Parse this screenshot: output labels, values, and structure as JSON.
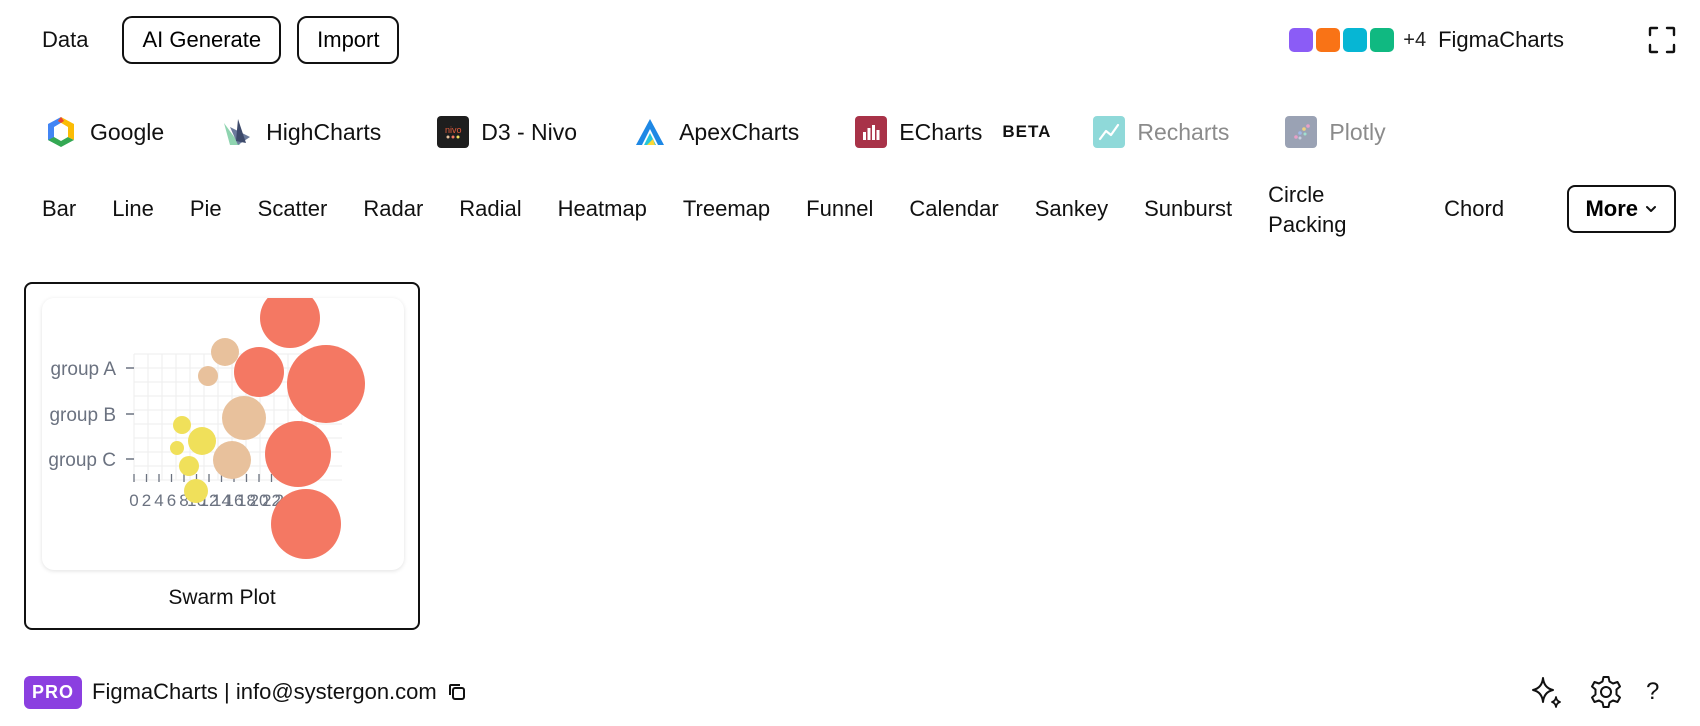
{
  "topbar": {
    "tab_data": "Data",
    "ai_generate_label": "AI Generate",
    "import_label": "Import",
    "brand": {
      "swatches": [
        "#8b5cf6",
        "#f97316",
        "#06b6d4",
        "#10b981"
      ],
      "extra_count": "+4",
      "name": "FigmaCharts"
    }
  },
  "libraries": [
    {
      "label": "Google",
      "icon": "google-logo-icon",
      "disabled": false
    },
    {
      "label": "HighCharts",
      "icon": "highcharts-logo-icon",
      "disabled": false
    },
    {
      "label": "D3 - Nivo",
      "icon": "nivo-logo-icon",
      "icon_text": "nivo",
      "disabled": false
    },
    {
      "label": "ApexCharts",
      "icon": "apexcharts-logo-icon",
      "disabled": false
    },
    {
      "label": "ECharts",
      "icon": "echarts-logo-icon",
      "badge": "BETA",
      "disabled": false
    },
    {
      "label": "Recharts",
      "icon": "recharts-logo-icon",
      "disabled": true
    },
    {
      "label": "Plotly",
      "icon": "plotly-logo-icon",
      "disabled": true
    }
  ],
  "chart_types": [
    "Bar",
    "Line",
    "Pie",
    "Scatter",
    "Radar",
    "Radial",
    "Heatmap",
    "Treemap",
    "Funnel",
    "Calendar",
    "Sankey",
    "Sunburst",
    "Circle Packing",
    "Chord"
  ],
  "more_label": "More",
  "card": {
    "label": "Swarm Plot",
    "thumbnail": {
      "groups": [
        "group A",
        "group B",
        "group C"
      ],
      "x_ticks": [
        "0",
        "2",
        "4",
        "6",
        "8",
        "10",
        "12",
        "14",
        "16",
        "18",
        "20",
        "22",
        "24"
      ],
      "colors": {
        "yellow": "#f0e05a",
        "tan": "#e8c19c",
        "coral": "#f47863",
        "text": "#6b7280",
        "grid": "#eeeeee"
      }
    }
  },
  "footer": {
    "badge": "PRO",
    "text": "FigmaCharts | info@systergon.com",
    "help": "?"
  }
}
